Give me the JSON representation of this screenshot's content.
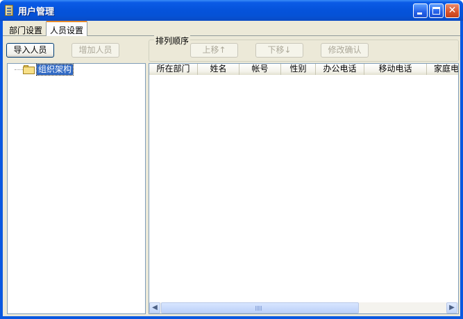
{
  "window": {
    "title": "用户管理"
  },
  "tabs": [
    {
      "label": "部门设置",
      "selected": false
    },
    {
      "label": "人员设置",
      "selected": true
    }
  ],
  "toolbar": {
    "import_label": "导入人员",
    "add_label": "增加人员",
    "add_enabled": false
  },
  "sort_group": {
    "legend": "排列顺序",
    "up_label": "上移↑",
    "down_label": "下移↓",
    "confirm_label": "修改确认",
    "enabled": false
  },
  "tree": {
    "nodes": [
      {
        "label": "组织架构",
        "icon": "folder-icon",
        "selected": true
      }
    ]
  },
  "list": {
    "columns": [
      "所在部门",
      "姓名",
      "帐号",
      "性别",
      "办公电话",
      "移动电话",
      "家庭电"
    ],
    "rows": []
  },
  "colors": {
    "titlebar": "#0553dc",
    "client_bg": "#ece9d8",
    "selection": "#316ac5",
    "tab_highlight": "#e68b2c"
  }
}
